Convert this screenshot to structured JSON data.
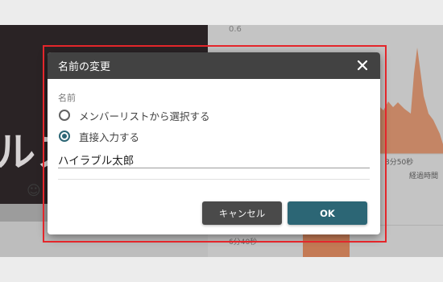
{
  "background": {
    "video_overlay_text": "ルス",
    "chart_axis_top": "0.6",
    "time_label_a": "8分50秒",
    "time_label_b": "経過時間",
    "time_label_c": "6分40秒",
    "smile_icon": "☺"
  },
  "dialog": {
    "title": "名前の変更",
    "close_icon": "close-icon",
    "section_label": "名前",
    "options": [
      {
        "label": "メンバーリストから選択する",
        "checked": false
      },
      {
        "label": "直接入力する",
        "checked": true
      }
    ],
    "name_value": "ハイラブル太郎",
    "cancel_label": "キャンセル",
    "ok_label": "OK"
  },
  "colors": {
    "header_bg": "#424242",
    "accent": "#2c6675",
    "cancel_bg": "#4a4a4a",
    "highlight": "#e4262b",
    "chart_orange": "#c47a55"
  }
}
